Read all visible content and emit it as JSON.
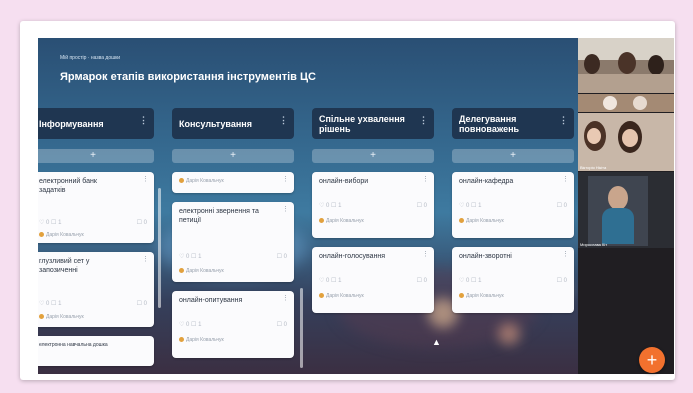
{
  "board": {
    "breadcrumb": "Мій простір · назва дошки",
    "title": "Ярмарок етапів використання інструментів ЦС"
  },
  "columns": [
    {
      "title": "Інформування",
      "cards": [
        {
          "text": "електронний банк\nзадатків",
          "author": "Дарія Ковальчук"
        },
        {
          "text": "глузливий сет у\nзапозиченні",
          "author": "Дарія Ковальчук"
        },
        {
          "text": "електронна навчальна дошка",
          "author": ""
        }
      ]
    },
    {
      "title": "Консультування",
      "cards": [
        {
          "text": "",
          "author": "Дарія Ковальчук"
        },
        {
          "text": "електронні звернення та\nпетиції",
          "author": "Дарія Ковальчук"
        },
        {
          "text": "онлайн-опитування",
          "author": "Дарія Ковальчук"
        }
      ]
    },
    {
      "title": "Спільне ухвалення\nрішень",
      "cards": [
        {
          "text": "онлайн-вибори",
          "author": "Дарія Ковальчук"
        },
        {
          "text": "онлайн-голосування",
          "author": "Дарія Ковальчук"
        }
      ]
    },
    {
      "title": "Делегування\nповноважень",
      "cards": [
        {
          "text": "онлайн-кафедра",
          "author": "Дарія Ковальчук"
        },
        {
          "text": "онлайн-зворотні",
          "author": "Дарія Ковальчук"
        }
      ]
    }
  ],
  "card_meta": {
    "left": "♡ 0  ☐ 1",
    "right": "☐ 0"
  },
  "add_symbol": "+",
  "menu_symbol": "⋮",
  "participants": [
    {
      "name": ""
    },
    {
      "name": ""
    },
    {
      "name": "Вікторія Нікіта"
    },
    {
      "name": "Мирослава Кіт"
    }
  ],
  "fab_symbol": "+",
  "colors": {
    "column_header": "#1f3651",
    "fab": "#f2712e",
    "background": "#f6dff0"
  }
}
